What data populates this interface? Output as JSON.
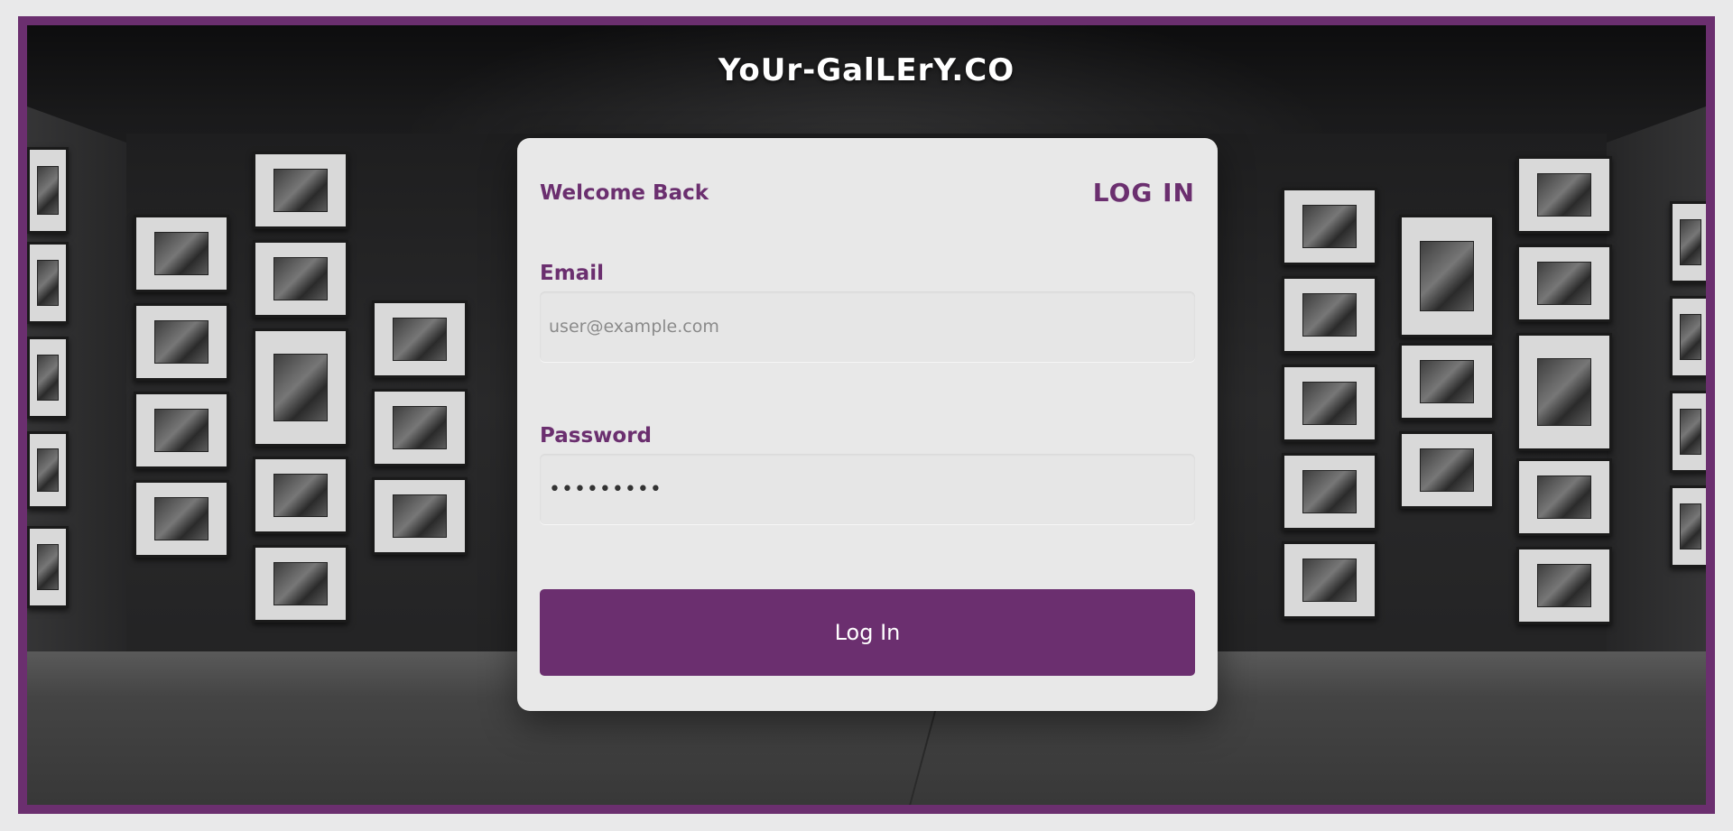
{
  "brand": {
    "title": "YoUr-GalLErY.CO"
  },
  "card": {
    "welcome_text": "Welcome Back",
    "title": "LOG IN",
    "email": {
      "label": "Email",
      "placeholder": "user@example.com",
      "value": ""
    },
    "password": {
      "label": "Password",
      "value": "•••••••••"
    },
    "submit_label": "Log In"
  },
  "colors": {
    "accent": "#6b2f6f",
    "card_background": "#e8e8e8",
    "page_background": "#e9e9ea"
  },
  "background": {
    "description_icon": "gallery-wall-image"
  }
}
